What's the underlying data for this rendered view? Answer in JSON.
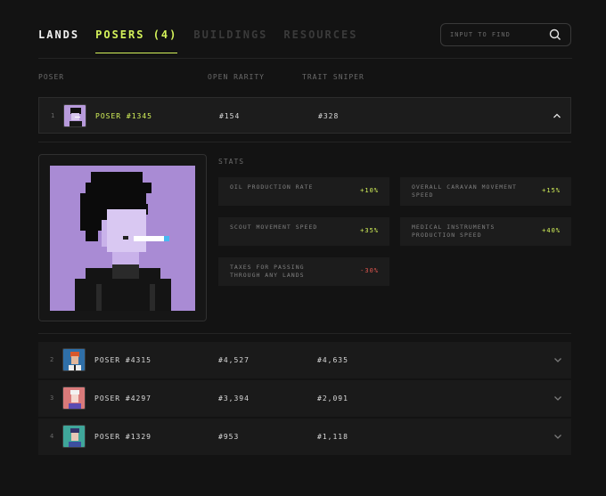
{
  "nav": {
    "tabs": [
      {
        "label": "Lands"
      },
      {
        "label": "Posers (4)"
      },
      {
        "label": "Buildings"
      },
      {
        "label": "Resources"
      }
    ]
  },
  "search": {
    "placeholder": "INPUT TO FIND",
    "value": ""
  },
  "table": {
    "headers": {
      "poser": "Poser",
      "open_rarity": "Open Rarity",
      "trait_sniper": "Trait Sniper"
    },
    "rows": [
      {
        "index": "1",
        "name": "POSER #1345",
        "open_rarity": "#154",
        "trait_sniper": "#328",
        "expanded": true
      },
      {
        "index": "2",
        "name": "POSER #4315",
        "open_rarity": "#4,527",
        "trait_sniper": "#4,635",
        "expanded": false
      },
      {
        "index": "3",
        "name": "POSER #4297",
        "open_rarity": "#3,394",
        "trait_sniper": "#2,091",
        "expanded": false
      },
      {
        "index": "4",
        "name": "POSER #1329",
        "open_rarity": "#953",
        "trait_sniper": "#1,118",
        "expanded": false
      }
    ]
  },
  "details": {
    "stats_title": "Stats",
    "stats": [
      {
        "label": "Oil production rate",
        "value": "+10%"
      },
      {
        "label": "Overall caravan movement speed",
        "value": "+15%"
      },
      {
        "label": "Scout movement speed",
        "value": "+35%"
      },
      {
        "label": "Medical instruments production speed",
        "value": "+40%"
      },
      {
        "label": "Taxes for passing through any lands",
        "value": "-30%"
      }
    ]
  },
  "colors": {
    "accent": "#d4f25a",
    "negative": "#e0574f",
    "background": "#131313",
    "row_bg": "#1a1a1a",
    "portrait_bg": "#a98bd4"
  },
  "icons": {
    "search": "search-icon",
    "expand": "chevron-down-icon",
    "collapse": "chevron-up-icon"
  }
}
